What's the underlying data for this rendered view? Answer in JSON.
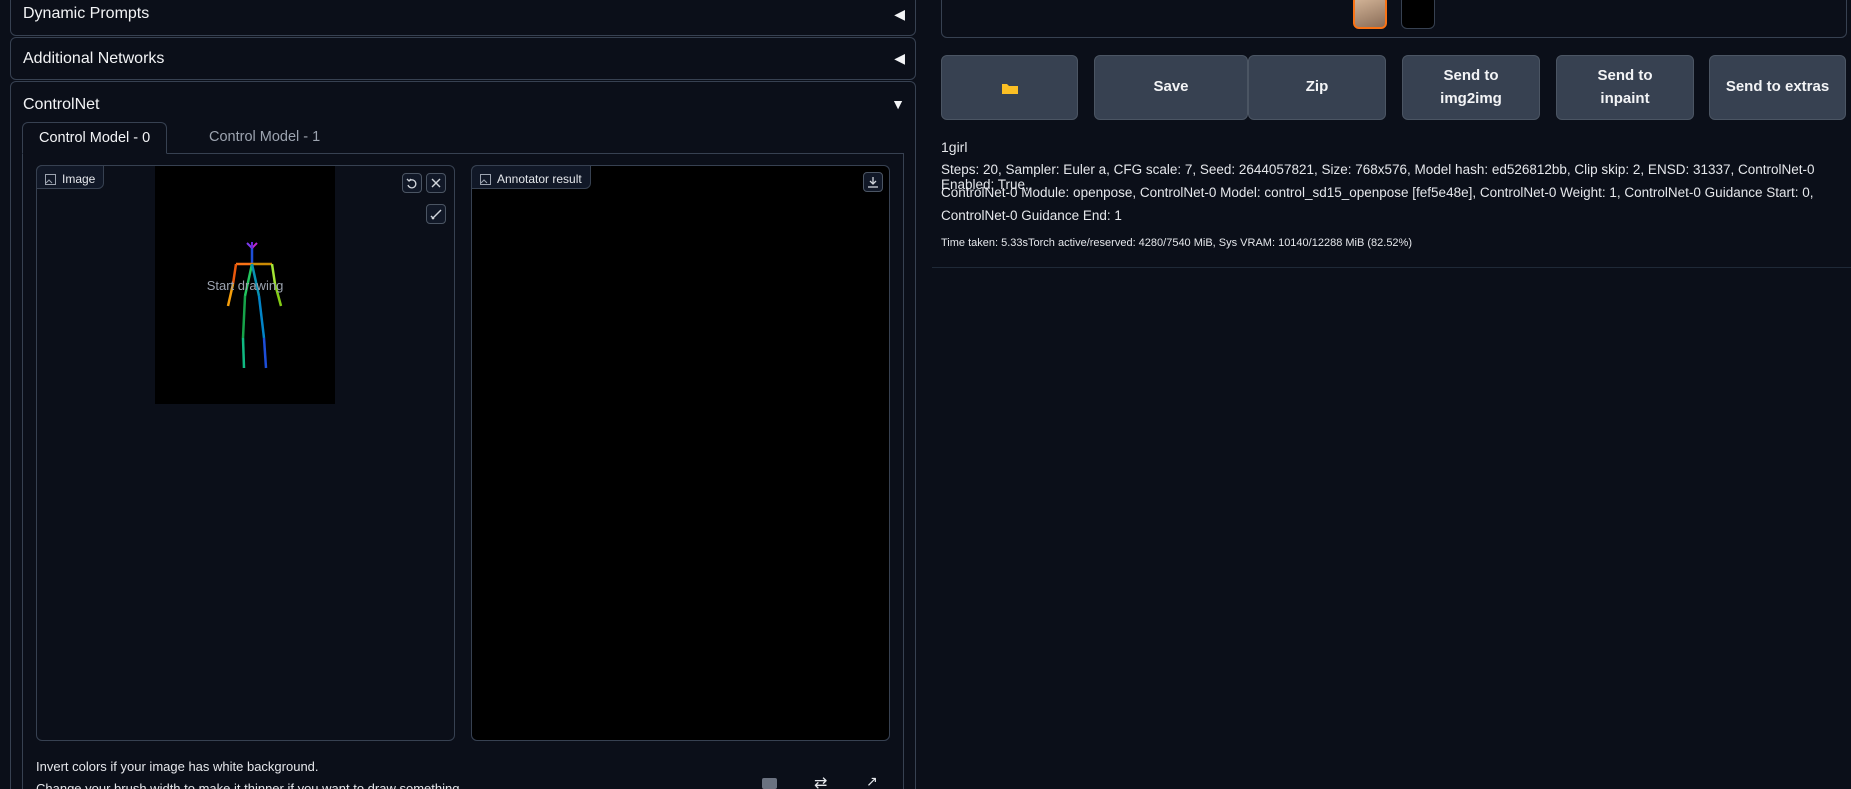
{
  "accordions": {
    "dynamic_prompts": "Dynamic Prompts",
    "additional_networks": "Additional Networks",
    "controlnet": "ControlNet"
  },
  "tabs": [
    "Control Model - 0",
    "Control Model - 1"
  ],
  "image_block": {
    "label": "Image",
    "overlay_text": "Start drawing"
  },
  "annotator_block": {
    "label": "Annotator result"
  },
  "hints": {
    "line1": "Invert colors if your image has white background.",
    "line2": "Change your brush width to make it thinner if you want to draw something."
  },
  "buttons": {
    "folder": "folder-icon",
    "save": "Save",
    "zip": "Zip",
    "send_img2img_l1": "Send to",
    "send_img2img_l2": "img2img",
    "send_inpaint_l1": "Send to",
    "send_inpaint_l2": "inpaint",
    "send_extras": "Send to extras"
  },
  "generation_info": {
    "prompt": "1girl",
    "params_line1": "Steps: 20, Sampler: Euler a, CFG scale: 7, Seed: 2644057821, Size: 768x576, Model hash: ed526812bb, Clip skip: 2, ENSD: 31337, ControlNet-0 Enabled: True,",
    "params_line2": "ControlNet-0 Module: openpose, ControlNet-0 Model: control_sd15_openpose [fef5e48e], ControlNet-0 Weight: 1, ControlNet-0 Guidance Start: 0,",
    "params_line3": "ControlNet-0 Guidance End: 1",
    "time_taken": "Time taken: 5.33sTorch active/reserved: 4280/7540 MiB, Sys VRAM: 10140/12288 MiB (82.52%)"
  },
  "colors": {
    "background": "#0b0f19",
    "border": "#374151",
    "button": "#374151",
    "selected_thumb_border": "#f97316",
    "folder": "#fbbf24"
  }
}
